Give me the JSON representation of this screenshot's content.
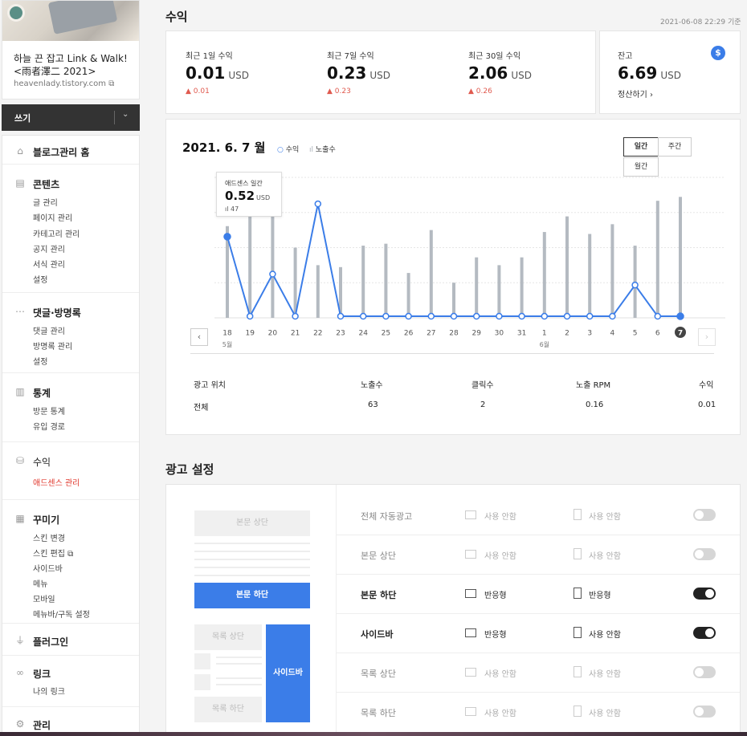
{
  "blog": {
    "title": "하늘 끈 잡고 Link & Walk! <雨者澤二 2021>",
    "url": "heavenlady.tistory.com"
  },
  "write": {
    "label": "쓰기"
  },
  "menu": [
    {
      "key": "home",
      "head": "블로그관리 홈",
      "subs": []
    },
    {
      "key": "contents",
      "head": "콘텐츠",
      "subs": [
        "글 관리",
        "페이지 관리",
        "카테고리 관리",
        "공지 관리",
        "서식 관리",
        "설정"
      ]
    },
    {
      "key": "comments",
      "head": "댓글·방명록",
      "subs": [
        "댓글 관리",
        "방명록 관리",
        "설정"
      ]
    },
    {
      "key": "stats",
      "head": "통계",
      "subs": [
        "방문 통계",
        "유입 경로"
      ]
    },
    {
      "key": "revenue",
      "head": "수익",
      "subs": [
        "애드센스 관리"
      ]
    },
    {
      "key": "design",
      "head": "꾸미기",
      "subs": [
        "스킨 변경",
        "스킨 편집",
        "사이드바",
        "메뉴",
        "모바일",
        "메뉴바/구독 설정"
      ]
    },
    {
      "key": "plugin",
      "head": "플러그인",
      "subs": []
    },
    {
      "key": "link",
      "head": "링크",
      "subs": [
        "나의 링크"
      ]
    },
    {
      "key": "manage",
      "head": "관리",
      "subs": []
    }
  ],
  "page": {
    "title": "수익",
    "timestamp": "2021-06-08 22:29 기준"
  },
  "stats": [
    {
      "label": "최근 1일 수익",
      "value": "0.01",
      "unit": "USD",
      "change": "0.01"
    },
    {
      "label": "최근 7일 수익",
      "value": "0.23",
      "unit": "USD",
      "change": "0.23"
    },
    {
      "label": "최근 30일 수익",
      "value": "2.06",
      "unit": "USD",
      "change": "0.26"
    }
  ],
  "balance": {
    "label": "잔고",
    "value": "6.69",
    "unit": "USD",
    "settle": "정산하기 ›",
    "icon": "dollar-icon",
    "arrow": "▲"
  },
  "chart": {
    "title": "2021. 6. 7 월",
    "legend_revenue": "수익",
    "legend_impr": "노출수",
    "periods": {
      "daily": "일간",
      "weekly": "주간",
      "monthly": "월간"
    },
    "prev": "‹",
    "next": "›",
    "tooltip": {
      "title": "애드센스 일간",
      "value": "0.52",
      "unit": "USD",
      "impr": "47"
    }
  },
  "chart_data": {
    "type": "bar+line",
    "categories": [
      "18",
      "19",
      "20",
      "21",
      "22",
      "23",
      "24",
      "25",
      "26",
      "27",
      "28",
      "29",
      "30",
      "31",
      "1",
      "2",
      "3",
      "4",
      "5",
      "6",
      "7"
    ],
    "month_labels": [
      {
        "index": 0,
        "label": "5월"
      },
      {
        "index": 14,
        "label": "6월"
      }
    ],
    "series": [
      {
        "name": "노출수",
        "type": "bar",
        "values": [
          47,
          58,
          58,
          36,
          27,
          26,
          37,
          38,
          23,
          45,
          18,
          31,
          27,
          31,
          44,
          52,
          43,
          48,
          37,
          60,
          62
        ]
      },
      {
        "name": "수익",
        "type": "line",
        "values": [
          0.52,
          0.01,
          0.28,
          0.01,
          0.73,
          0.01,
          0.01,
          0.01,
          0.01,
          0.01,
          0.01,
          0.01,
          0.01,
          0.01,
          0.01,
          0.01,
          0.01,
          0.01,
          0.21,
          0.01,
          0.01
        ]
      }
    ],
    "ylim_revenue": [
      0,
      0.9
    ],
    "ylim_impr": [
      0,
      72
    ],
    "selected_index": 20,
    "highlight_index": 0,
    "grid": true
  },
  "table": {
    "headers": [
      "광고 위치",
      "노출수",
      "클릭수",
      "노출 RPM",
      "수익"
    ],
    "row": [
      "전체",
      "63",
      "2",
      "0.16",
      "0.01"
    ]
  },
  "ads": {
    "title": "광고 설정",
    "preview": {
      "top": "본문 상단",
      "bottom": "본문 하단",
      "list_top": "목록 상단",
      "list_bottom": "목록 하단",
      "sidebar": "사이드바"
    },
    "rows": [
      {
        "name": "전체 자동광고",
        "pc": "사용 안함",
        "mobile": "사용 안함",
        "on": false
      },
      {
        "name": "본문 상단",
        "pc": "사용 안함",
        "mobile": "사용 안함",
        "on": false
      },
      {
        "name": "본문 하단",
        "pc": "반응형",
        "mobile": "반응형",
        "on": true
      },
      {
        "name": "사이드바",
        "pc": "반응형",
        "mobile": "사용 안함",
        "on": true
      },
      {
        "name": "목록 상단",
        "pc": "사용 안함",
        "mobile": "사용 안함",
        "on": false
      },
      {
        "name": "목록 하단",
        "pc": "사용 안함",
        "mobile": "사용 안함",
        "on": false
      }
    ]
  }
}
